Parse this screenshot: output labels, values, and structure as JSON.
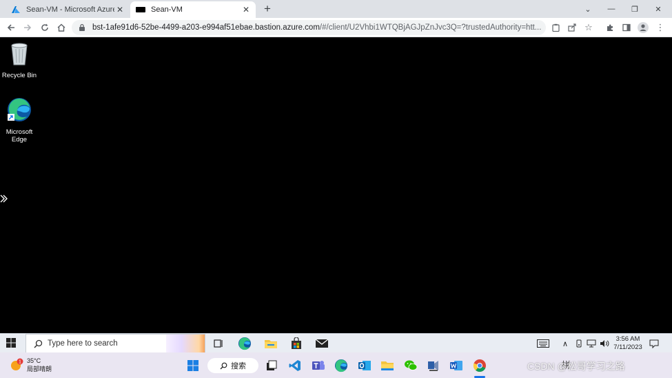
{
  "browser": {
    "tabs": [
      {
        "title": "Sean-VM - Microsoft Azure",
        "active": false,
        "favicon": "azure-icon"
      },
      {
        "title": "Sean-VM",
        "active": true,
        "favicon": "vm-terminal-icon"
      }
    ],
    "url_host": "bst-1afe91d6-52be-4499-a203-e994af51ebae.bastion.azure.com",
    "url_rest": "/#/client/U2Vhbi1WTQBjAGJpZnJvc3Q=?trustedAuthority=htt..."
  },
  "desktop": {
    "icons": [
      {
        "label": "Recycle Bin",
        "icon": "recycle-bin-icon"
      },
      {
        "label": "Microsoft Edge",
        "icon": "edge-icon"
      }
    ]
  },
  "vm_taskbar": {
    "search_placeholder": "Type here to search",
    "apps": [
      "task-view-icon",
      "edge-icon",
      "file-explorer-icon",
      "store-icon",
      "mail-icon"
    ],
    "time": "3:56 AM",
    "date": "7/11/2023"
  },
  "host_taskbar": {
    "weather_temp": "35°C",
    "weather_desc": "局部晴朗",
    "weather_badge": "1",
    "search_label": "搜索",
    "ime": "拼",
    "watermark": "CSDN @松哥学习之路"
  },
  "colors": {
    "chrome_tabstrip": "#dee1e6",
    "desktop_bg": "#000000",
    "vm_taskbar": "#e9edf3",
    "host_taskbar": "#eae6f2",
    "azure_blue": "#0078d4"
  }
}
